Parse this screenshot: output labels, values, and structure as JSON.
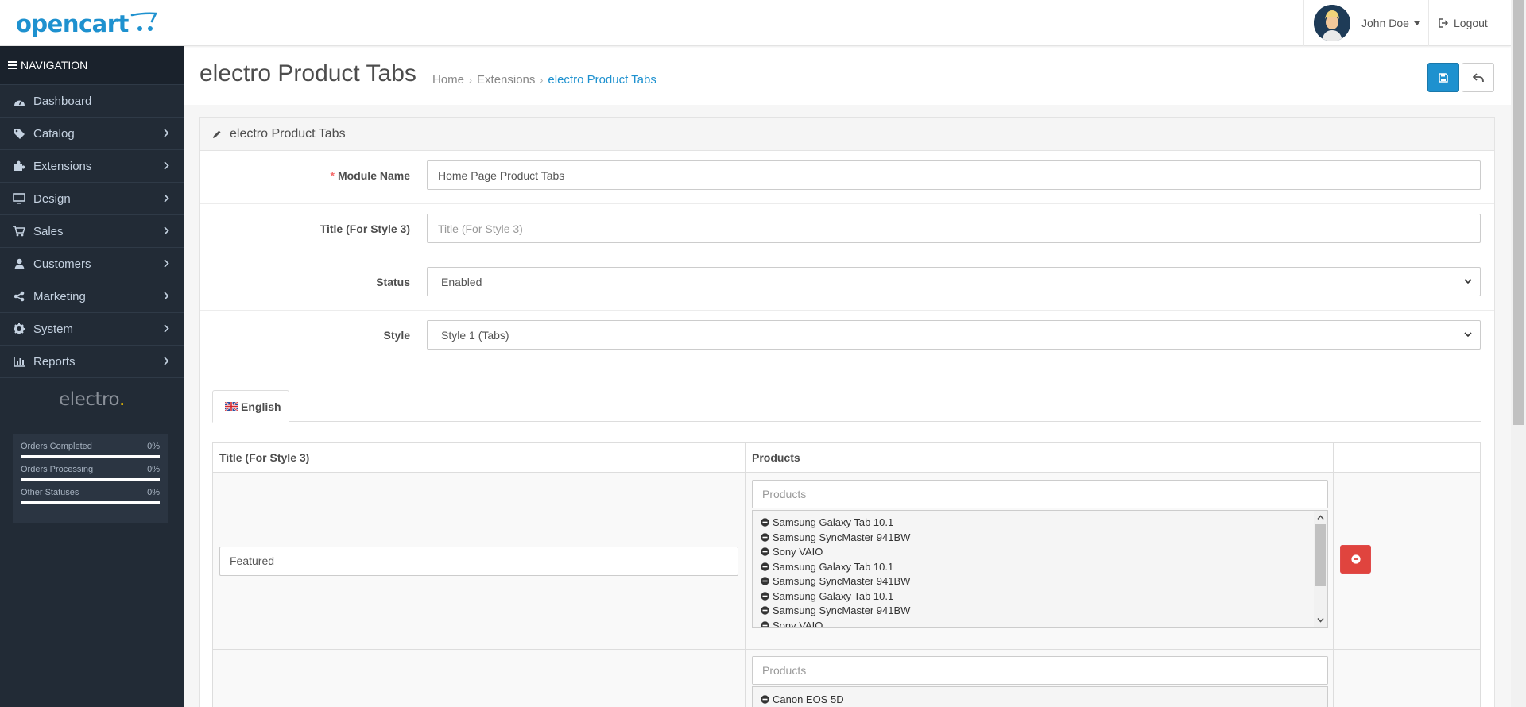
{
  "header": {
    "logo_text": "opencart",
    "user_name": "John Doe",
    "logout_label": "Logout"
  },
  "sidebar": {
    "heading": "NAVIGATION",
    "items": [
      {
        "label": "Dashboard",
        "icon": "dashboard-icon"
      },
      {
        "label": "Catalog",
        "icon": "tags-icon"
      },
      {
        "label": "Extensions",
        "icon": "puzzle-icon"
      },
      {
        "label": "Design",
        "icon": "monitor-icon"
      },
      {
        "label": "Sales",
        "icon": "cart-icon"
      },
      {
        "label": "Customers",
        "icon": "user-icon"
      },
      {
        "label": "Marketing",
        "icon": "share-icon"
      },
      {
        "label": "System",
        "icon": "gear-icon"
      },
      {
        "label": "Reports",
        "icon": "bar-chart-icon"
      }
    ],
    "brand_logo": "electro",
    "stats": [
      {
        "label": "Orders Completed",
        "value": "0%"
      },
      {
        "label": "Orders Processing",
        "value": "0%"
      },
      {
        "label": "Other Statuses",
        "value": "0%"
      }
    ]
  },
  "page": {
    "title": "electro Product Tabs",
    "breadcrumb": [
      "Home",
      "Extensions",
      "electro Product Tabs"
    ]
  },
  "panel": {
    "heading": "electro Product Tabs",
    "module_name": {
      "label": "Module Name",
      "value": "Home Page Product Tabs"
    },
    "title_style3": {
      "label": "Title (For Style 3)",
      "placeholder": "Title (For Style 3)"
    },
    "status": {
      "label": "Status",
      "value": "Enabled"
    },
    "style": {
      "label": "Style",
      "value": "Style 1 (Tabs)"
    },
    "language_tab": "English",
    "table": {
      "headers": [
        "Title (For Style 3)",
        "Products",
        ""
      ],
      "rows": [
        {
          "title": "Featured",
          "products_placeholder": "Products",
          "products": [
            "Samsung Galaxy Tab 10.1",
            "Samsung SyncMaster 941BW",
            "Sony VAIO",
            "Samsung Galaxy Tab 10.1",
            "Samsung SyncMaster 941BW",
            "Samsung Galaxy Tab 10.1",
            "Samsung SyncMaster 941BW",
            "Sony VAIO"
          ]
        },
        {
          "title": "",
          "products_placeholder": "Products",
          "products": [
            "Canon EOS 5D"
          ]
        }
      ]
    }
  },
  "colors": {
    "primary": "#1e91cf",
    "sidebar_bg": "#222b36",
    "danger": "#e0443e"
  }
}
